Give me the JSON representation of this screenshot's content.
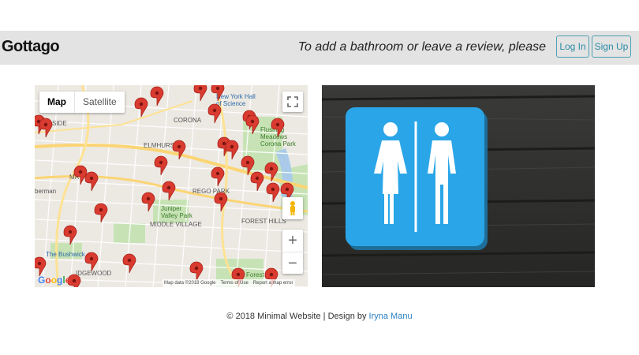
{
  "header": {
    "brand": "Gottago",
    "prompt": "To add a bathroom or leave a review, please",
    "login_label": "Log In",
    "signup_label": "Sign Up",
    "accent_color": "#2a8ca6"
  },
  "map": {
    "type_map": "Map",
    "type_satellite": "Satellite",
    "zoom_in": "+",
    "zoom_out": "−",
    "google": "Google",
    "attribution": {
      "data": "Map data ©2018 Google",
      "terms": "Terms of Use",
      "report": "Report a map error"
    },
    "labels": {
      "corona": "CORONA",
      "elmhurst": "ELMHURST",
      "rego_park": "REGO PARK",
      "juniper_valley": "Juniper\nValley Park",
      "middle_village": "MIDDLE VILLAGE",
      "forest_hills": "FOREST HILLS",
      "flushing": "Flushing\nMeadows\nCorona Park",
      "bushwick": "The Bushwick",
      "ridgewood": "IDGEWOOD",
      "forest": "Forest",
      "ny_hall": "New York Hall\nof Science",
      "side": "SIDE",
      "ma": "MA",
      "berman": "berman"
    },
    "pin_color": "#d93b30"
  },
  "footer": {
    "text": "© 2018 Minimal Website | Design by",
    "author": "Iryna Manu"
  },
  "colors": {
    "sign_blue": "#2aa6e8",
    "wood": "#2f2f2e"
  }
}
